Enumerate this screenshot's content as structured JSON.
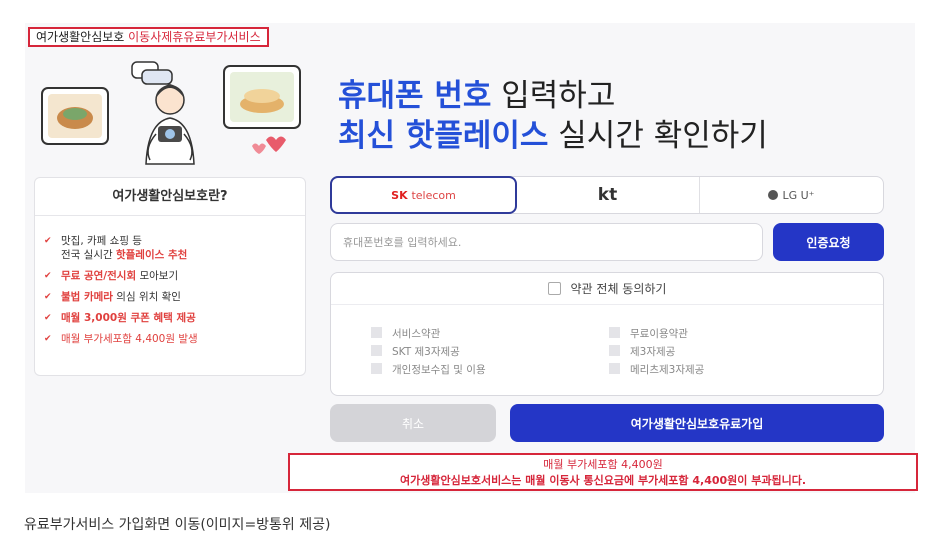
{
  "header": {
    "label_part1": "여가생활안심보호 ",
    "label_part2": "이동사제휴유료부가서비스"
  },
  "headline": {
    "line1_accent": "휴대폰 번호",
    "line1_rest": " 입력하고",
    "line2_accent": "최신 핫플레이스",
    "line2_rest": " 실시간 확인하기"
  },
  "info_card": {
    "title": "여가생활안심보호란?",
    "items": [
      {
        "line1": "맛집, 카페 쇼핑 등",
        "line2_prefix": "전국 실시간 ",
        "line2_highlight": "핫플레이스 추천"
      },
      {
        "highlight": "무료 공연/전시회",
        "rest": " 모아보기"
      },
      {
        "highlight": "불법 카메라",
        "rest": " 의심 위치 확인"
      },
      {
        "text": "매월 3,000원 쿠폰 혜택 제공"
      },
      {
        "text": "매월 부가세포함 4,400원 발생"
      }
    ]
  },
  "carriers": {
    "sk_brand": "SK",
    "sk_sub": "telecom",
    "kt": "kt",
    "lgu": "LG U⁺",
    "selected": "SK telecom"
  },
  "phone": {
    "placeholder": "휴대폰번호를 입력하세요.",
    "value": ""
  },
  "auth_button": "인증요청",
  "terms": {
    "agree_all": "약관 전체 동의하기",
    "left": [
      "서비스약관",
      "SKT 제3자제공",
      "개인정보수집 및 이용"
    ],
    "right": [
      "무료이용약관",
      "제3자제공",
      "메리츠제3자제공"
    ]
  },
  "buttons": {
    "cancel": "취소",
    "join": "여가생활안심보호유료가입"
  },
  "notice": {
    "line1": "매월 부가세포함 4,400원",
    "line2": "여가생활안심보호서비스는 매월 이동사 통신요금에 부가세포함 4,400원이 부과됩니다."
  },
  "caption": "유료부가서비스 가입화면 이동(이미지=방통위 제공)",
  "colors": {
    "accent_blue": "#2450d8",
    "button_blue": "#2436c6",
    "alert_red": "#d6263a"
  }
}
